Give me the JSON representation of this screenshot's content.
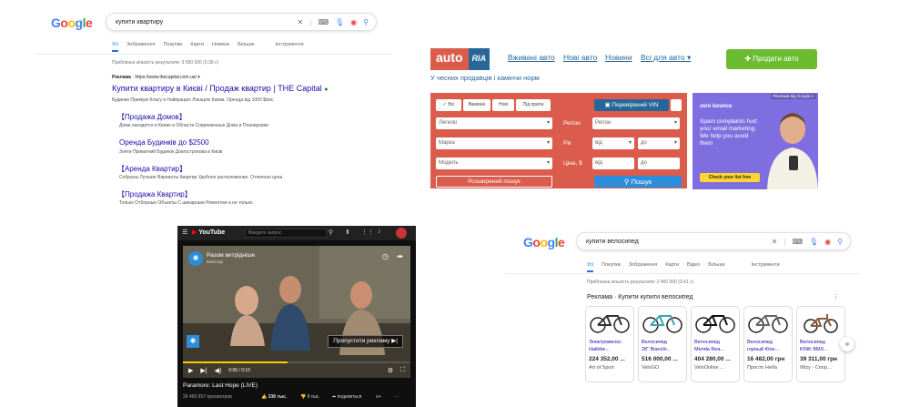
{
  "google1": {
    "logo": [
      "G",
      "o",
      "o",
      "g",
      "l",
      "e"
    ],
    "query": "купити квартиру",
    "tabs": [
      "Усі",
      "Зображення",
      "Покупки",
      "Карти",
      "Новини",
      "Більше",
      "Інструменти"
    ],
    "result_count": "Приблизна кількість результатів: 9 580 000 (0,38 с)",
    "ad_label": "Реклама",
    "ad_url": "· https://www.thecapital.com.ua/ ▾",
    "ad_title": "Купити квартиру в Києві / Продаж квартир | THE Capital",
    "ad_desc": "Будинки Преміум Класу в Найкращих Локаціях Києва. Оренда від 1000 $/міс.",
    "sitelinks": [
      {
        "title": "【Продажа Домов】",
        "desc": "Дома находятся в Киеве и Области Современные Дома и Планировки"
      },
      {
        "title": "Оренда Будинків до $2500",
        "desc": "Зняти Приватний Будинок Довгострокова в Києві"
      },
      {
        "title": "【Аренда Квартир】",
        "desc": "Собраны Лучшие Варианты Квартир Удобное расположение. Отличная цена"
      },
      {
        "title": "【Продажа Квартир】",
        "desc": "Только Отборные Объекты С шикарным Ремонтом и не только"
      }
    ]
  },
  "autoria": {
    "logo_auto": "auto",
    "logo_ria": "RIA",
    "nav": [
      "Вживані авто",
      "Нові авто",
      "Новини",
      "Всі для авто ▾"
    ],
    "sell_button": "Продати авто",
    "tagline": "У чесних продавців і камінчи норм",
    "tabs": [
      "✓ Всі",
      "Вживані",
      "Нові",
      "Під пригін"
    ],
    "vin_button": "Перевірений VIN",
    "fields": {
      "type": "Легкові",
      "brand": "Марка",
      "model": "Модель",
      "region_label": "Регіон",
      "region": "Регіон",
      "year_label": "Рік",
      "year_from": "від",
      "year_to": "до",
      "price_label": "Ціна, $",
      "price_from": "від",
      "price_to": "до"
    },
    "advanced_button": "Розширений пошук",
    "search_button": "Пошук",
    "ad": {
      "label": "Реклама від Google ▷",
      "brand": "zero bounce",
      "text": "Spam complaints hurt your email marketing. We help you avoid them",
      "cta": "Check your list free"
    }
  },
  "youtube": {
    "logo": "YouTube",
    "search_placeholder": "Введите запрос",
    "video_title": "Разом витрідніше",
    "video_sub": "Київстар",
    "skip": "Пропустити рекламу ▶|",
    "time": "0:06 / 0:13",
    "title": "Paramore: Last Hope (LIVE)",
    "views": "26 469 657 просмотров",
    "likes": "338 тыс.",
    "dislikes": "9 тыс.",
    "share": "поделиться",
    "progress": 0.46
  },
  "google2": {
    "logo": [
      "G",
      "o",
      "o",
      "g",
      "l",
      "e"
    ],
    "query": "купити велосипед",
    "tabs": [
      "Усі",
      "Покупки",
      "Зображення",
      "Карти",
      "Відео",
      "Більше",
      "Інструменти"
    ],
    "result_count": "Приблизна кількість результатів: 2 460 000 (0,41 с)",
    "ad_heading": "Реклама · Купити  купити велосипед",
    "products": [
      {
        "name1": "Электровелос",
        "name2": "Haibike...",
        "price": "224 352,00 ...",
        "shop": "Art of Sport"
      },
      {
        "name1": "Велосипед",
        "name2": "28\" Bianchi...",
        "price": "516 000,00 ...",
        "shop": "VeloGO"
      },
      {
        "name1": "Велосипед",
        "name2": "Merida Rea...",
        "price": "404 280,00 ...",
        "shop": "VeloOnline ..."
      },
      {
        "name1": "Велосипед",
        "name2": "горный Kine...",
        "price": "16 482,00 грн",
        "shop": "Просто Неба"
      },
      {
        "name1": "Велосипед",
        "name2": "KINK BMX...",
        "price": "39 311,00 грн",
        "shop": "Wizy - Спор..."
      }
    ]
  },
  "colors": {
    "google_blue": "#4285f4",
    "link_blue": "#1a0dab",
    "autoria_red": "#db5c4c",
    "autoria_blue": "#256799",
    "autoria_green": "#6bbc31",
    "zerobounce_purple": "#7f6edf"
  }
}
